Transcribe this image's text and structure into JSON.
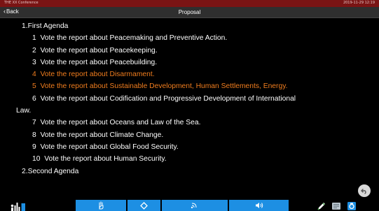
{
  "status_bar": {
    "left_text": "THE XX Conference",
    "right_text": "2019-11-29 12:19"
  },
  "header": {
    "back_label": "Back",
    "title": "Proposal"
  },
  "agenda": {
    "first_heading": "1.First Agenda",
    "items": [
      {
        "number": "1",
        "text": "Vote the report about Peacemaking and Preventive Action."
      },
      {
        "number": "2",
        "text": "Vote the report about Peacekeeping."
      },
      {
        "number": "3",
        "text": "Vote the report about Peacebuilding."
      },
      {
        "number": "4",
        "text": "Vote the report about Disarmament."
      },
      {
        "number": "5",
        "text": "Vote the report about Sustainable Development, Human Settlements, Energy."
      },
      {
        "number": "6",
        "text": "Vote the report about Codification and Progressive Development of International",
        "continuation": "Law."
      },
      {
        "number": "7",
        "text": "Vote the report about Oceans and Law of the Sea."
      },
      {
        "number": "8",
        "text": "Vote the report about Climate Change."
      },
      {
        "number": "9",
        "text": "Vote the report about Global Food Security."
      },
      {
        "number": "10",
        "text": "Vote the report about Human Security."
      }
    ],
    "second_heading": "2.Second Agenda"
  },
  "highlighted_items": [
    "4",
    "5"
  ],
  "colors": {
    "highlight": "#f07d1e",
    "toolbar_blue": "#1d8fe3",
    "status_bar": "#7a1414"
  },
  "icons": {
    "back": "chevron-left-icon",
    "fab": "undo-icon",
    "logo": "equalizer-logo-icon",
    "toolbar": [
      "hand-raise-icon",
      "diamond-icon",
      "signal-icon",
      "speaker-icon"
    ],
    "right": [
      "pen-icon",
      "document-icon",
      "camera-icon"
    ]
  }
}
